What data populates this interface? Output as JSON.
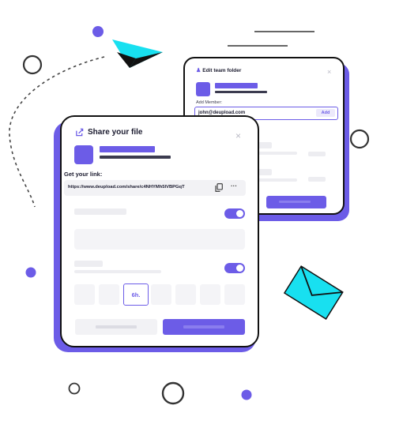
{
  "edit_dialog": {
    "title": "Edit team folder",
    "close": "×",
    "add_member_label": "Add Member:",
    "email_value": "john@deupload.com",
    "add_button": "Add"
  },
  "share_dialog": {
    "title": "Share your file",
    "close": "×",
    "link_label": "Get your link:",
    "link_url": "https://www.deupload.com/share/c4NHYMh5IVBPGqT",
    "more": "···",
    "time_selected": "6h."
  },
  "icons": {
    "share": "share-icon",
    "copy": "copy-icon",
    "more": "more-icon",
    "person": "person-icon",
    "close": "close-icon",
    "paper_plane": "paper-plane-icon",
    "envelope": "envelope-icon"
  },
  "colors": {
    "accent": "#6c5ce7",
    "cyan": "#18e0f0",
    "outline": "#111111"
  }
}
